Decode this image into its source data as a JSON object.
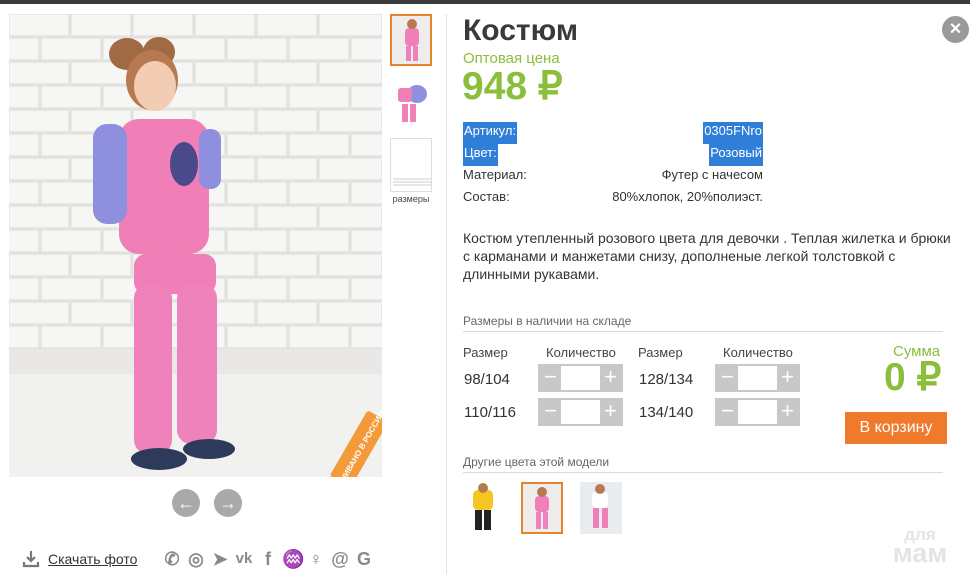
{
  "product": {
    "title": "Костюм",
    "price_label": "Оптовая цена",
    "price": "948 ₽"
  },
  "specs": [
    {
      "key": "Артикул:",
      "value": "0305FNro",
      "highlighted": true
    },
    {
      "key": "Цвет:",
      "value": "Розовый",
      "highlighted": true
    },
    {
      "key": "Материал:",
      "value": "Футер с начесом",
      "highlighted": false
    },
    {
      "key": "Состав:",
      "value": "80%хлопок, 20%полиэст.",
      "highlighted": false
    }
  ],
  "description": "Костюм утепленный розового цвета для девочки . Теплая жилетка и брюки с карманами и манжетами снизу, дополненые легкой толстовкой с длинными рукавами.",
  "thumbs": {
    "sizes_label": "размеры"
  },
  "photo_stamp": "СШИВАНО В РОССИИ",
  "sizes": {
    "section_title": "Размеры в наличии на складе",
    "col_size": "Размер",
    "col_qty": "Количество",
    "rows": [
      {
        "left": "98/104",
        "right": "128/134"
      },
      {
        "left": "110/116",
        "right": "134/140"
      }
    ],
    "minus": "−",
    "plus": "+"
  },
  "sum": {
    "label": "Сумма",
    "value": "0 ₽"
  },
  "cart_button": "В корзину",
  "other_colors_title": "Другие цвета этой модели",
  "download": {
    "label": "Скачать фото"
  },
  "close": "×",
  "nav": {
    "prev": "←",
    "next": "→"
  },
  "watermark": {
    "line1": "для",
    "line2": "мам"
  },
  "colors": {
    "accent_green": "#8bbe3a",
    "accent_orange": "#f07a2c",
    "highlight_blue": "#2f7fd8"
  }
}
